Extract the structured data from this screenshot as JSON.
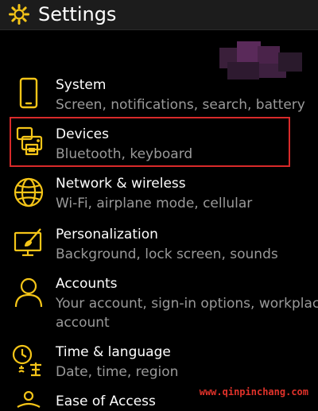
{
  "header": {
    "title": "Settings",
    "icon": "gear-icon"
  },
  "items": [
    {
      "title": "System",
      "subtitle": "Screen, notifications, search, battery",
      "icon": "phone-icon"
    },
    {
      "title": "Devices",
      "subtitle": "Bluetooth, keyboard",
      "icon": "devices-printer-icon"
    },
    {
      "title": "Network & wireless",
      "subtitle": "Wi-Fi, airplane mode, cellular",
      "icon": "globe-icon"
    },
    {
      "title": "Personalization",
      "subtitle": "Background, lock screen, sounds",
      "icon": "paintbrush-monitor-icon"
    },
    {
      "title": "Accounts",
      "subtitle": "Your account, sign-in options, workplace",
      "subtitle2": "account",
      "icon": "person-icon"
    },
    {
      "title": "Time & language",
      "subtitle": "Date, time, region",
      "icon": "clock-language-icon"
    },
    {
      "title": "Ease of Access",
      "icon": "ease-of-access-icon"
    }
  ],
  "watermark": "www.qinpinchang.com",
  "colors": {
    "accent": "#f5c518",
    "background": "#000000",
    "header_bg": "#1c1c1c",
    "title_text": "#ffffff",
    "subtitle_text": "#9a9a9a",
    "highlight": "#d82a2a",
    "watermark": "#e0322a"
  }
}
